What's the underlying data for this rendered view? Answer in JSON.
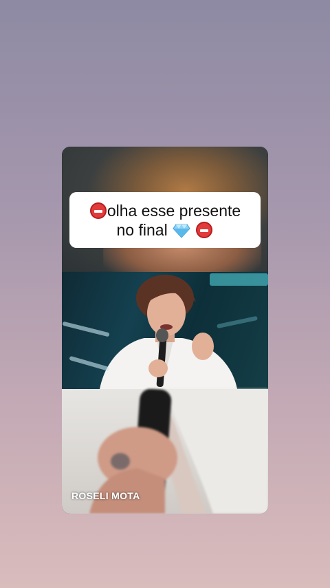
{
  "caption": {
    "line1": "olha esse presente",
    "line2": "no final",
    "icons": [
      "no-entry-icon",
      "gem-icon",
      "no-entry-icon"
    ]
  },
  "watermark": {
    "text": "ROSELI MOTA"
  },
  "colors": {
    "background_top": "#8e8aa3",
    "background_bottom": "#d9bcbc",
    "no_entry_red": "#e23b3b"
  }
}
